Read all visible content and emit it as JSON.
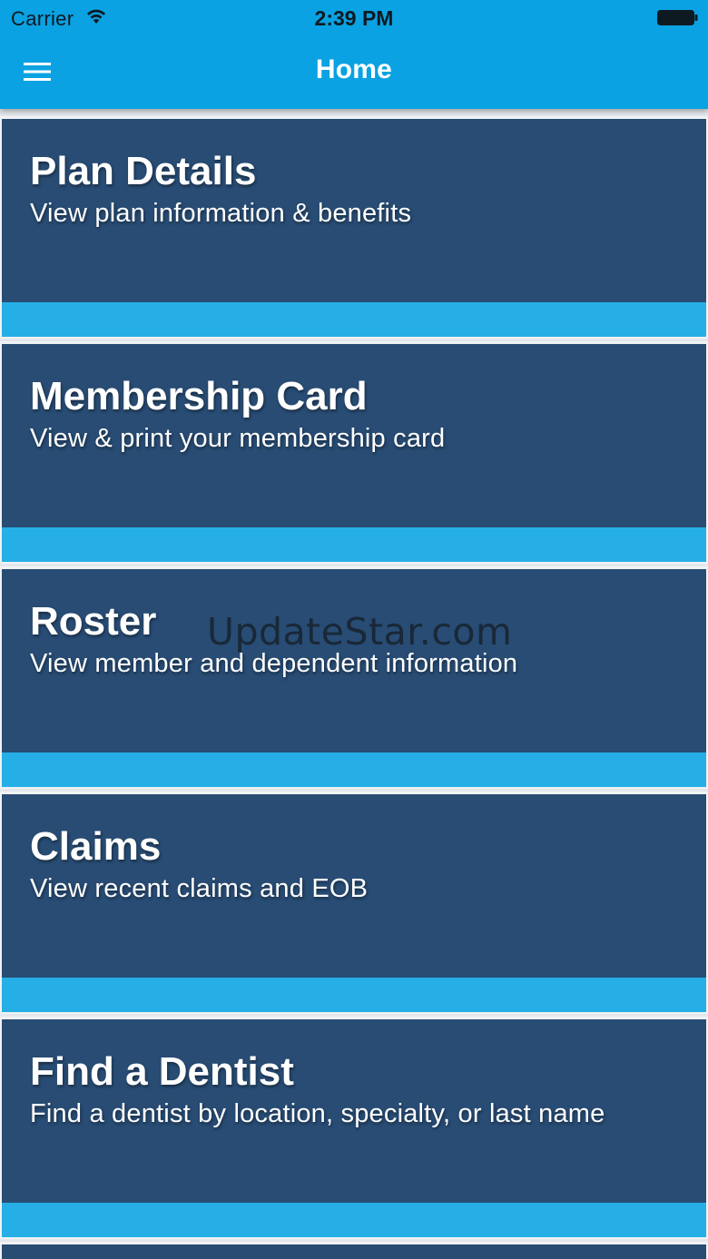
{
  "status_bar": {
    "carrier": "Carrier",
    "time": "2:39 PM",
    "wifi_icon": "wifi-icon",
    "battery_icon": "battery-icon"
  },
  "nav": {
    "title": "Home",
    "menu_icon": "hamburger-menu-icon"
  },
  "colors": {
    "nav_bar": "#0aa2e2",
    "tile_background": "#284c74",
    "tile_accent_strip": "#25afe6",
    "tile_text": "#ffffff"
  },
  "tiles": [
    {
      "title": "Plan Details",
      "subtitle": "View plan information & benefits"
    },
    {
      "title": "Membership Card",
      "subtitle": "View & print your membership card"
    },
    {
      "title": "Roster",
      "subtitle": "View member and dependent information"
    },
    {
      "title": "Claims",
      "subtitle": "View recent claims and EOB"
    },
    {
      "title": "Find a Dentist",
      "subtitle": "Find a dentist by location, specialty, or last name"
    }
  ],
  "watermark": "UpdateStar.com"
}
